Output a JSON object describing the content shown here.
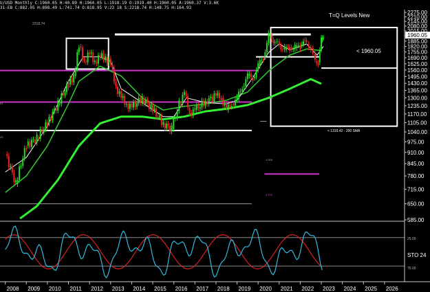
{
  "header": {
    "line1": "U/USD Monthly C:1960.05 H:40.89 H:1964.05 L:1918.19 O:1919.40 H:1960.05 A:1960.37 V:3.6K",
    "line2": "31-EB C:882.05 H:898.49 L:741.74 O:818.95 V:23 18 S:2218.74 H:148.75 H:164.93"
  },
  "annotations": {
    "title": "T=Q Levels New",
    "price_callout": "< 1960.05",
    "sma_callout": "< 1319.42 - 200 SMA",
    "peak_label": "2218.74",
    "box_top_label": ".000",
    "box_mid_label": "500",
    "box_bottom_label": "1.000",
    "level_left_1": "01",
    "level_left_2": "23",
    "level_magenta": "1.272",
    "stoch_upper": "25.00",
    "stoch_lower": "75.00",
    "stoch_label": "STO 24"
  },
  "colors": {
    "background": "#000000",
    "candle_up": "#22dd22",
    "candle_down": "#ee2222",
    "sma_short": "#ffffff",
    "sma_mid": "#33cc33",
    "sma_long": "#33ee33",
    "magenta": "#cc33cc",
    "stoch_k": "#33bbdd",
    "stoch_d": "#dd2222",
    "price_badge_bg": "#ffffff"
  },
  "chart_data": {
    "type": "candlestick",
    "title": "T=Q Levels New",
    "x_axis": {
      "ticks": [
        "2008",
        "2009",
        "2010",
        "2011",
        "2012",
        "2013",
        "2014",
        "2015",
        "2016",
        "2017",
        "2018",
        "2019",
        "2020",
        "2021",
        "2022",
        "2023",
        "2024",
        "2025",
        "2026"
      ]
    },
    "y_axis": {
      "scale": "log",
      "range": [
        585,
        2275
      ],
      "ticks": [
        2275,
        2210,
        2145,
        2080,
        2015,
        1950,
        1885,
        1820,
        1755,
        1690,
        1625,
        1560,
        1495,
        1430,
        1365,
        1300,
        1235,
        1170,
        1105,
        1040,
        975,
        910,
        845,
        780,
        715,
        650,
        585
      ],
      "last_price": 1960.05
    },
    "series": [
      {
        "name": "Price",
        "type": "candlestick",
        "x": [
          2008.0,
          2008.5,
          2009.0,
          2009.5,
          2010.0,
          2010.5,
          2011.0,
          2011.25,
          2011.5,
          2011.75,
          2012.0,
          2012.25,
          2012.5,
          2012.75,
          2013.0,
          2013.25,
          2013.5,
          2013.75,
          2014.0,
          2014.5,
          2015.0,
          2015.5,
          2015.9,
          2016.25,
          2016.5,
          2016.75,
          2017.0,
          2017.5,
          2018.0,
          2018.25,
          2018.5,
          2018.75,
          2019.0,
          2019.25,
          2019.5,
          2019.75,
          2020.0,
          2020.25,
          2020.5,
          2020.65,
          2020.8,
          2021.0,
          2021.25,
          2021.5,
          2021.75,
          2022.0,
          2022.15,
          2022.3,
          2022.5,
          2022.7,
          2022.85,
          2023.0,
          2023.1
        ],
        "close": [
          900,
          740,
          950,
          1000,
          1100,
          1250,
          1420,
          1500,
          1820,
          1650,
          1740,
          1650,
          1700,
          1700,
          1620,
          1400,
          1300,
          1250,
          1220,
          1300,
          1200,
          1100,
          1060,
          1250,
          1340,
          1180,
          1200,
          1270,
          1320,
          1300,
          1200,
          1250,
          1290,
          1400,
          1500,
          1480,
          1600,
          1700,
          1950,
          1900,
          1880,
          1830,
          1780,
          1810,
          1800,
          1830,
          1900,
          1850,
          1800,
          1650,
          1640,
          1900,
          1960.05
        ]
      }
    ],
    "moving_averages": [
      {
        "name": "200 SMA",
        "last_value": 1319.42
      }
    ],
    "horizontal_levels": [
      1960.05,
      1885,
      1700,
      1580,
      1450,
      1050,
      790,
      650
    ],
    "oscillator": {
      "name": "STO 24",
      "levels": [
        25,
        75
      ]
    }
  }
}
